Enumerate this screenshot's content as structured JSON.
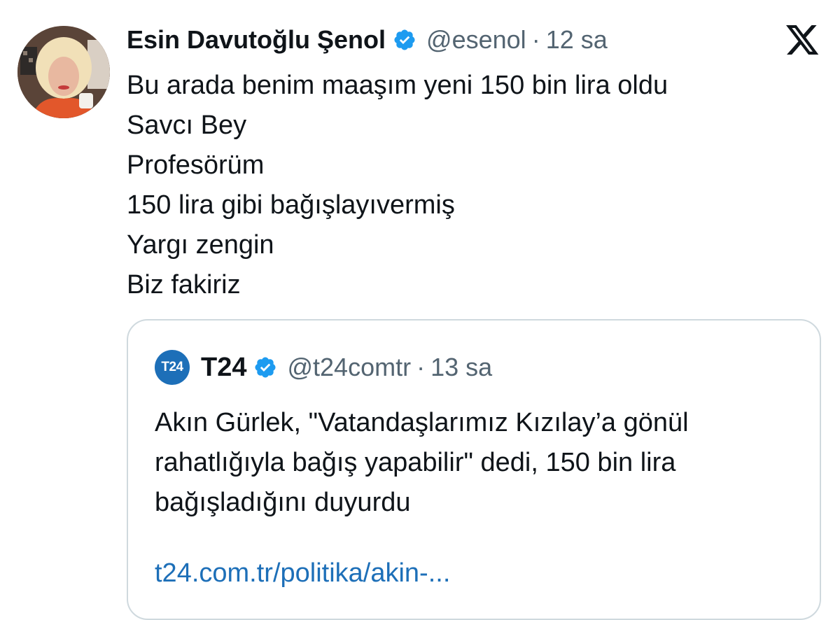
{
  "tweet": {
    "display_name": "Esin Davutoğlu Şenol",
    "handle": "@esenol",
    "separator": "·",
    "time": "12 sa",
    "verified_icon": "verified-badge-icon",
    "lines": [
      "Bu arada benim maaşım yeni 150 bin lira oldu",
      "Savcı Bey",
      "Profesörüm",
      "150 lira gibi bağışlayıvermiş",
      "Yargı zengin",
      "Biz fakiriz"
    ]
  },
  "platform_logo": "x-logo-icon",
  "quote": {
    "avatar_label": "T24",
    "display_name": "T24",
    "handle": "@t24comtr",
    "separator": "·",
    "time": "13 sa",
    "text": "Akın Gürlek, \"Vatandaşlarımız Kızılay’a gönül rahatlığıyla bağış yapabilir\" dedi, 150 bin lira bağışladığını duyurdu",
    "link": "t24.com.tr/politika/akin-..."
  },
  "colors": {
    "text": "#0f1419",
    "secondary": "#536471",
    "verified": "#1d9bf0",
    "link": "#1d6fb8",
    "border": "#cfd9de"
  }
}
